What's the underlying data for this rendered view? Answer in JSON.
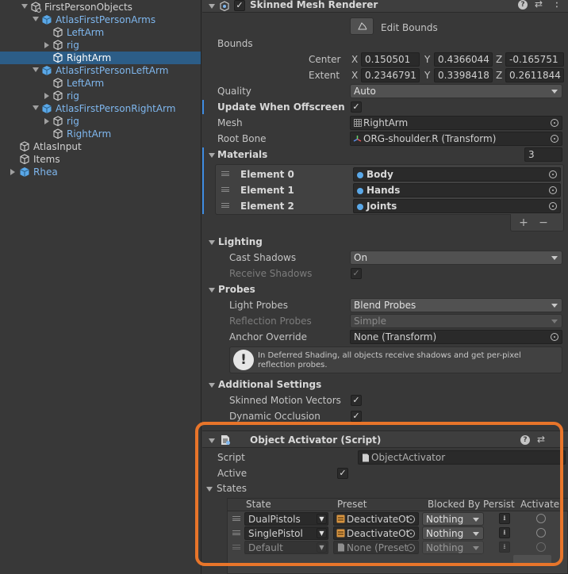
{
  "hierarchy": {
    "items": [
      {
        "label": "FirstPersonObjects",
        "color": "white"
      },
      {
        "label": "AtlasFirstPersonArms",
        "color": "blue"
      },
      {
        "label": "LeftArm",
        "color": "blue"
      },
      {
        "label": "rig",
        "color": "blue"
      },
      {
        "label": "RightArm",
        "color": "white"
      },
      {
        "label": "AtlasFirstPersonLeftArm",
        "color": "blue"
      },
      {
        "label": "LeftArm",
        "color": "blue"
      },
      {
        "label": "rig",
        "color": "blue"
      },
      {
        "label": "AtlasFirstPersonRightArm",
        "color": "blue"
      },
      {
        "label": "rig",
        "color": "blue"
      },
      {
        "label": "RightArm",
        "color": "blue"
      },
      {
        "label": "AtlasInput",
        "color": "white"
      },
      {
        "label": "Items",
        "color": "white"
      },
      {
        "label": "Rhea",
        "color": "blue"
      }
    ]
  },
  "skinned": {
    "title": "Skinned Mesh Renderer",
    "edit_bounds": "Edit Bounds",
    "bounds_label": "Bounds",
    "center_label": "Center",
    "extent_label": "Extent",
    "axis_x": "X",
    "axis_y": "Y",
    "axis_z": "Z",
    "center": {
      "x": "0.150501",
      "y": "0.4366044",
      "z": "-0.165751"
    },
    "extent": {
      "x": "0.2346791",
      "y": "0.3398418",
      "z": "0.2611844"
    },
    "quality_label": "Quality",
    "quality_value": "Auto",
    "update_offscreen_label": "Update When Offscreen",
    "mesh_label": "Mesh",
    "mesh_value": "RightArm",
    "root_bone_label": "Root Bone",
    "root_bone_value": "ORG-shoulder.R (Transform)",
    "materials_label": "Materials",
    "materials_count": "3",
    "elements": [
      {
        "label": "Element 0",
        "value": "Body"
      },
      {
        "label": "Element 1",
        "value": "Hands"
      },
      {
        "label": "Element 2",
        "value": "Joints"
      }
    ],
    "plus": "+",
    "minus": "−",
    "lighting_label": "Lighting",
    "cast_shadows_label": "Cast Shadows",
    "cast_shadows_value": "On",
    "receive_shadows_label": "Receive Shadows",
    "probes_label": "Probes",
    "light_probes_label": "Light Probes",
    "light_probes_value": "Blend Probes",
    "reflection_probes_label": "Reflection Probes",
    "reflection_probes_value": "Simple",
    "anchor_override_label": "Anchor Override",
    "anchor_override_value": "None (Transform)",
    "info_text": "In Deferred Shading, all objects receive shadows and get per-pixel reflection probes.",
    "additional_label": "Additional Settings",
    "skinned_motion_label": "Skinned Motion Vectors",
    "dynamic_occlusion_label": "Dynamic Occlusion"
  },
  "activator": {
    "title": "Object Activator (Script)",
    "script_label": "Script",
    "script_value": "ObjectActivator",
    "active_label": "Active",
    "states_label": "States",
    "columns": [
      "State",
      "Preset",
      "Blocked By",
      "Persist",
      "Activate"
    ],
    "rows": [
      {
        "state": "DualPistols",
        "preset": "DeactivateOt",
        "blocked": "Nothing"
      },
      {
        "state": "SinglePistol",
        "preset": "DeactivateOt",
        "blocked": "Nothing"
      },
      {
        "state": "Default",
        "preset": "None (Preset",
        "blocked": "Nothing"
      }
    ]
  },
  "colors": {
    "highlight": "#e8752a",
    "selection": "#2c5d87",
    "link_blue": "#7fb7ee"
  }
}
